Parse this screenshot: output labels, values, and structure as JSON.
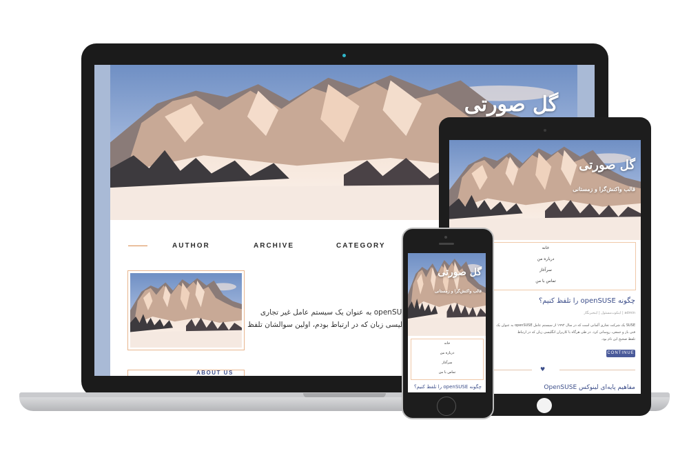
{
  "laptop": {
    "site_title": "گل صورتی",
    "nav": [
      "AUTHOR",
      "ARCHIVE",
      "CATEGORY"
    ],
    "post_line1": "عامل openSUSE به عنوان یک سیستم عامل غیر تجاری",
    "post_line2": "ی و انگلیسی زبان که در ارتباط بودم، اولین سوالشان تلفظ",
    "about_label": "ABOUT US"
  },
  "tablet": {
    "site_title": "گل صورتی",
    "subtitle": "قالب واکنش‌گرا و زمستانی",
    "menu": [
      "خانه",
      "درباره من",
      "سرآغاز",
      "تماس با من"
    ],
    "post_title": "چگونه openSUSE را تلفظ کنیم؟",
    "meta": "admin | اینکوت‌مسئول | اینخبرنگار",
    "excerpt_lines": [
      "SUSE یک شرکت تجاری آلمانی است که در سال ۱۹۹۲ از سیستم عامل openSUSE به عنوان یک",
      "فنی باز و جمعی، روسانی کرد. در طی هرگاه با کاربران انگلیسی زبان که در ارتباط",
      "تلفظ صحیح این نام بود."
    ],
    "continue_label": "CONTINUE",
    "second_title": "مفاهیم پایه‌ای لینوکس OpenSUSE"
  },
  "phone": {
    "site_title": "گل صورتی",
    "subtitle": "قالب واکنش‌گرا و زمستانی",
    "menu": [
      "خانه",
      "درباره من",
      "سرآغاز",
      "تماس با من"
    ],
    "post_title": "چگونه openSUSE را تلفظ کنیم؟"
  },
  "colors": {
    "accent_orange": "#d9884a",
    "accent_blue": "#3b4d89",
    "device_black": "#1b1b1b",
    "screen_frame_blue": "#a9bad6"
  }
}
